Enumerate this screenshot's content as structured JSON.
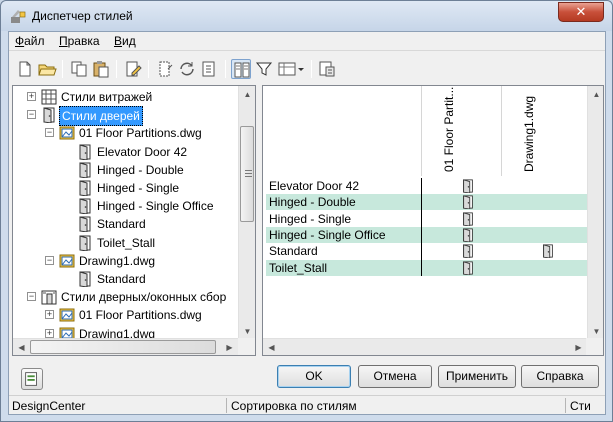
{
  "window": {
    "title": "Диспетчер стилей",
    "close": "✕"
  },
  "menu": [
    {
      "first": "Ф",
      "rest": "айл"
    },
    {
      "first": "П",
      "rest": "равка"
    },
    {
      "first": "В",
      "rest": "ид"
    }
  ],
  "toolbar": {
    "icons": [
      "new-icon",
      "open-icon",
      "copy-icon",
      "paste-icon",
      "edit-icon",
      "purge-icon",
      "sync-icon",
      "properties-icon",
      "toggle-view-icon",
      "filter-icon",
      "view-options-icon",
      "refresh-icon"
    ]
  },
  "tree": {
    "items": [
      {
        "label": "Стили витражей",
        "level": 1,
        "expander": "+",
        "icon": "curtain-wall-icon"
      },
      {
        "label": "Стили дверей",
        "level": 1,
        "expander": "−",
        "icon": "door-icon",
        "selected": true
      },
      {
        "label": "01 Floor Partitions.dwg",
        "level": 2,
        "expander": "−",
        "icon": "drawing-icon"
      },
      {
        "label": "Elevator Door 42",
        "level": 3,
        "icon": "door-icon"
      },
      {
        "label": "Hinged - Double",
        "level": 3,
        "icon": "door-icon"
      },
      {
        "label": "Hinged - Single",
        "level": 3,
        "icon": "door-icon"
      },
      {
        "label": "Hinged - Single Office",
        "level": 3,
        "icon": "door-icon"
      },
      {
        "label": "Standard",
        "level": 3,
        "icon": "door-icon"
      },
      {
        "label": "Toilet_Stall",
        "level": 3,
        "icon": "door-icon"
      },
      {
        "label": "Drawing1.dwg",
        "level": 2,
        "expander": "−",
        "icon": "drawing-icon"
      },
      {
        "label": "Standard",
        "level": 3,
        "icon": "door-icon"
      },
      {
        "label": "Стили дверных/оконных сбор",
        "level": 1,
        "expander": "−",
        "icon": "door-window-icon"
      },
      {
        "label": "01 Floor Partitions.dwg",
        "level": 2,
        "expander": "+",
        "icon": "drawing-icon"
      },
      {
        "label": "Drawing1.dwg",
        "level": 2,
        "expander": "+",
        "icon": "drawing-icon"
      }
    ]
  },
  "matrix": {
    "columns": [
      "01 Floor Partit...",
      "Drawing1.dwg"
    ],
    "rows": [
      {
        "name": "Elevator Door 42",
        "cells": [
          true,
          false
        ]
      },
      {
        "name": "Hinged - Double",
        "cells": [
          true,
          false
        ]
      },
      {
        "name": "Hinged - Single",
        "cells": [
          true,
          false
        ]
      },
      {
        "name": "Hinged - Single Office",
        "cells": [
          true,
          false
        ]
      },
      {
        "name": "Standard",
        "cells": [
          true,
          true
        ]
      },
      {
        "name": "Toilet_Stall",
        "cells": [
          true,
          false
        ]
      }
    ]
  },
  "buttons": {
    "ok": "OK",
    "cancel": "Отмена",
    "apply": "Применить",
    "help": "Справка"
  },
  "status": {
    "left": "DesignCenter",
    "middle": "Сортировка по стилям",
    "right": "Сти"
  }
}
